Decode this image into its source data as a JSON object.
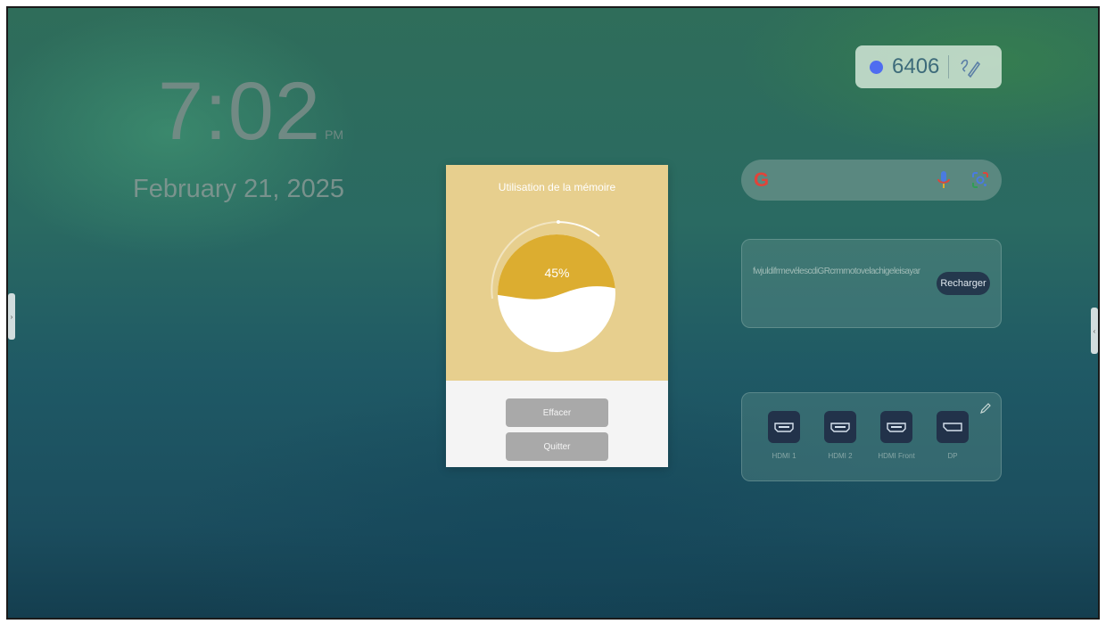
{
  "clock": {
    "time": "7:02",
    "ampm": "PM",
    "date": "February 21, 2025"
  },
  "badge": {
    "code": "6406",
    "dot_color": "#4f6df0",
    "icon": "pen-scribble-icon"
  },
  "search": {
    "logo": "G",
    "icons": [
      "mic-icon",
      "google-lens-icon"
    ]
  },
  "reload_card": {
    "message": "fwjuldifrmevélescdiGRcrmrnotovelachigeleisayar",
    "button_label": "Recharger"
  },
  "sources": {
    "items": [
      {
        "label": "HDMI 1",
        "icon": "hdmi-port-icon"
      },
      {
        "label": "HDMI 2",
        "icon": "hdmi-port-icon"
      },
      {
        "label": "HDMI Front",
        "icon": "hdmi-port-icon"
      },
      {
        "label": "DP",
        "icon": "displayport-icon"
      }
    ],
    "edit_icon": "pencil-icon"
  },
  "side_handles": {
    "left": "›",
    "right": "‹"
  },
  "dialog": {
    "title": "Utilisation de la mémoire",
    "percent_label": "45%",
    "memory_usage": 0.45,
    "accent_color": "#dcad30",
    "header_color": "#e7cf8e",
    "clear_label": "Effacer",
    "quit_label": "Quitter"
  }
}
